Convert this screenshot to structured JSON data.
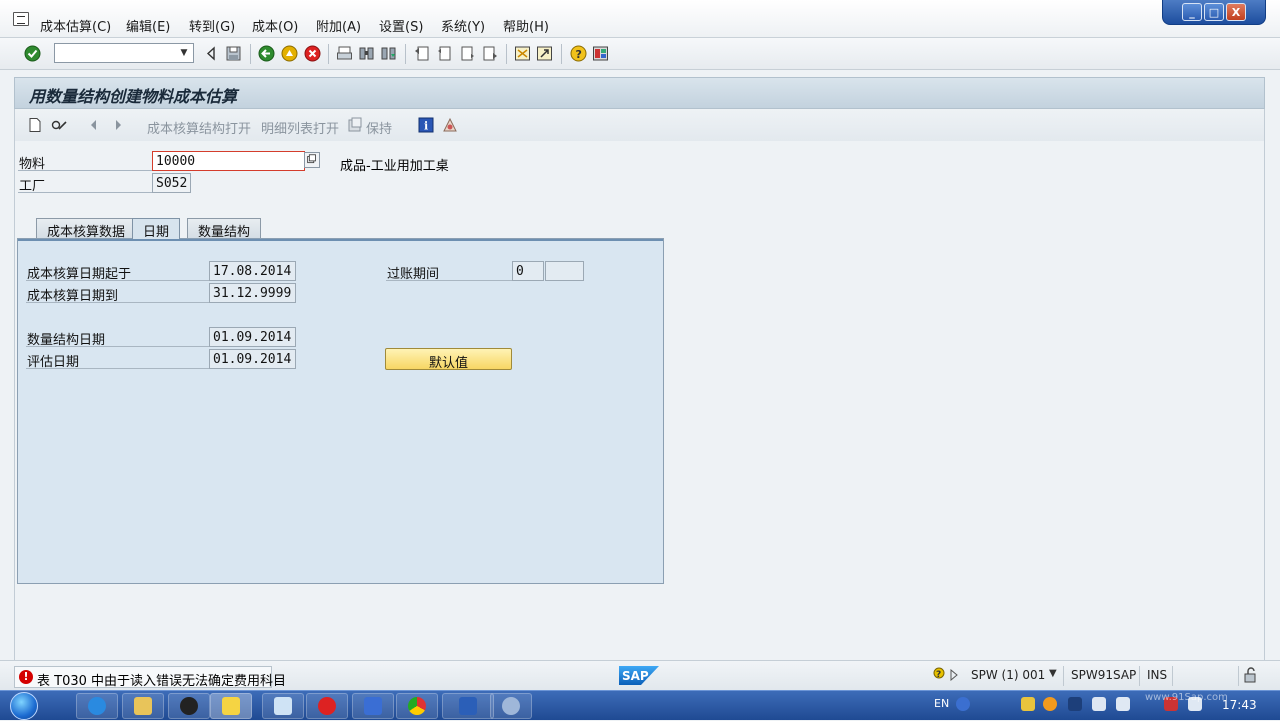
{
  "menu": {
    "items": [
      "成本估算(C)",
      "编辑(E)",
      "转到(G)",
      "成本(O)",
      "附加(A)",
      "设置(S)",
      "系统(Y)",
      "帮助(H)"
    ]
  },
  "window_controls": {
    "minimize": "_",
    "maximize": "□",
    "close": "X"
  },
  "command_field": {
    "value": ""
  },
  "title": "用数量结构创建物料成本估算",
  "app_toolbar": {
    "open_costing_structure": "成本核算结构打开",
    "open_itemization": "明细列表打开",
    "save": "保持"
  },
  "header": {
    "material_label": "物料",
    "material_value": "10000",
    "material_desc": "成品-工业用加工桌",
    "plant_label": "工厂",
    "plant_value": "S052"
  },
  "tabs": [
    "成本核算数据",
    "日期",
    "数量结构"
  ],
  "active_tab": "日期",
  "dates": {
    "costing_from_label": "成本核算日期起于",
    "costing_from_value": "17.08.2014",
    "costing_to_label": "成本核算日期到",
    "costing_to_value": "31.12.9999",
    "qty_struct_label": "数量结构日期",
    "qty_struct_value": "01.09.2014",
    "valuation_label": "评估日期",
    "valuation_value": "01.09.2014",
    "posting_period_label": "过账期间",
    "posting_period_value": "0",
    "posting_year_value": "",
    "default_button": "默认值"
  },
  "status": {
    "message": "表 T030 中由于读入错误无法确定费用科目",
    "sap_logo_text": "SAP",
    "system": "SPW (1) 001",
    "server": "SPW91SAP",
    "mode": "INS"
  },
  "taskbar": {
    "lang": "EN",
    "clock": "17:43",
    "watermark": "www.91Sap.com"
  },
  "colors": {
    "accent": "#1f4a93",
    "button_default": "#f7d664",
    "error_red": "#d40000"
  }
}
